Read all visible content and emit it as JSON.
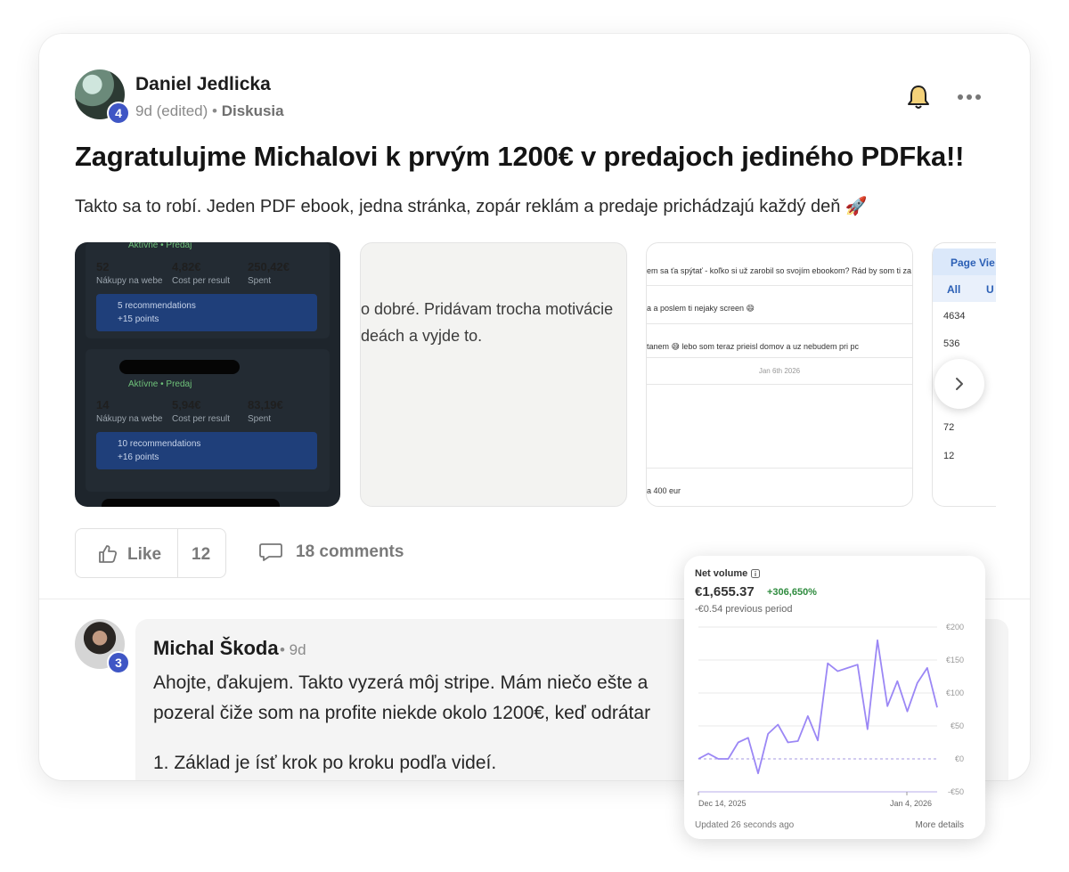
{
  "post": {
    "author": "Daniel Jedlicka",
    "author_level": "4",
    "time": "9d (edited)",
    "bullet": " • ",
    "category": "Diskusia",
    "title": "Zagratulujme Michalovi k prvým 1200€ v predajoch jediného PDFka!!",
    "body": "Takto sa to robí. Jeden PDF ebook, jedna stránka, zopár reklám a predaje prichádzajú každý deň 🚀",
    "icons": [
      "bell-icon",
      "more-icon",
      "like-icon",
      "comment-icon",
      "chevron-right-icon"
    ]
  },
  "thumb1": {
    "status": "Aktívne • Predaj",
    "ad1": {
      "purchases": "52",
      "purchases_label": "Nákupy na webe",
      "cpr": "4,82€",
      "cpr_label": "Cost per result",
      "spent": "250,42€",
      "spent_label": "Spent",
      "reco": "5 recommendations",
      "points": "+15 points"
    },
    "ad2": {
      "purchases": "14",
      "purchases_label": "Nákupy na webe",
      "cpr": "5,94€",
      "cpr_label": "Cost per result",
      "spent": "83,19€",
      "spent_label": "Spent",
      "reco": "10 recommendations",
      "points": "+16 points"
    }
  },
  "thumb2": {
    "line1": "o dobré. Pridávam trocha motivácie",
    "line2": "deách a vyjde to."
  },
  "thumb3": {
    "msg1": "em sa ťa spýtať - koľko si už zarobil so svojím ebookom? Rád by som ti za",
    "msg2": "a a poslem ti nejaky screen 😄",
    "msg3": "tanem 😅 lebo som teraz prieisl domov a uz nebudem pri pc",
    "date": "Jan 6th 2026",
    "msg4": "a 400 eur"
  },
  "thumb4": {
    "header": "Page Vie",
    "tab1": "All",
    "tab2": "U",
    "values": [
      "4634",
      "536",
      "72",
      "12"
    ]
  },
  "actions": {
    "like_label": "Like",
    "like_count": "12",
    "comments_label": "18 comments"
  },
  "comment": {
    "author": "Michal Škoda",
    "author_level": "3",
    "time": "• 9d",
    "line1": "Ahojte, ďakujem. Takto vyzerá môj stripe. Mám niečo ešte a",
    "line2": "pozeral čiže som na profite niekde okolo 1200€, keď odrátar",
    "line3": "1. Základ je ísť krok po kroku podľa videí."
  },
  "stripe": {
    "title": "Net volume",
    "value": "€1,655.37",
    "delta": "+306,650%",
    "previous": "-€0.54 previous period",
    "updated": "Updated 26 seconds ago",
    "more": "More details"
  },
  "chart_data": {
    "type": "line",
    "title": "Net volume",
    "x_start_label": "Dec 14, 2025",
    "x_end_label": "Jan 4, 2026",
    "ylim": [
      -50,
      200
    ],
    "y_ticks": [
      "€200",
      "€150",
      "€100",
      "€50",
      "€0",
      "-€50"
    ],
    "y_tick_values": [
      200,
      150,
      100,
      50,
      0,
      -50
    ],
    "grid": true,
    "series": [
      {
        "values": [
          0,
          8,
          0,
          0,
          25,
          32,
          -22,
          38,
          52,
          25,
          27,
          65,
          28,
          145,
          133,
          138,
          143,
          45,
          180,
          80,
          118,
          72,
          115,
          138,
          78
        ]
      },
      {
        "values": [
          0,
          0,
          0,
          0,
          0,
          0,
          0,
          0,
          0,
          0,
          0,
          0,
          0,
          0,
          0,
          0,
          0,
          0,
          0,
          0,
          0,
          0,
          0,
          0,
          0
        ]
      }
    ],
    "colors": {
      "line": "#9b87f5",
      "baseline": "#b7aee8",
      "grid": "#e8e8e8"
    }
  }
}
